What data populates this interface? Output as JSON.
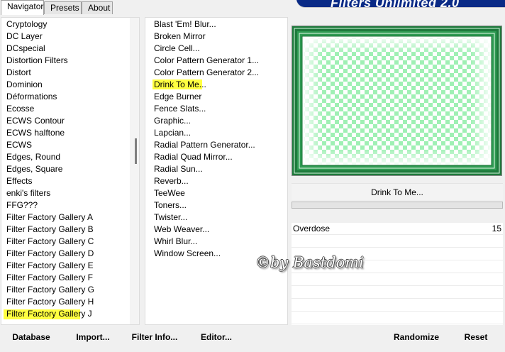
{
  "tabs": [
    {
      "label": "Navigator",
      "active": true
    },
    {
      "label": "Presets",
      "active": false
    },
    {
      "label": "About",
      "active": false
    }
  ],
  "banner": {
    "title": "Filters Unlimited 2.0"
  },
  "categories": [
    "Cryptology",
    "DC Layer",
    "DCspecial",
    "Distortion Filters",
    "Distort",
    "Dominion",
    "Déformations",
    "Ecosse",
    "ECWS Contour",
    "ECWS halftone",
    "ECWS",
    "Edges, Round",
    "Edges, Square",
    "Effects",
    "enki's filters",
    "FFG???",
    "Filter Factory Gallery A",
    "Filter Factory Gallery B",
    "Filter Factory Gallery C",
    "Filter Factory Gallery D",
    "Filter Factory Gallery E",
    "Filter Factory Gallery F",
    "Filter Factory Gallery G",
    "Filter Factory Gallery H",
    "Filter Factory Gallery J"
  ],
  "selected_category": "Filter Factory Gallery J",
  "filters": [
    "Blast 'Em! Blur...",
    "Broken Mirror",
    "Circle Cell...",
    "Color Pattern Generator 1...",
    "Color Pattern Generator 2...",
    "Drink To Me...",
    "Edge Burner",
    "Fence Slats...",
    "Graphic...",
    "Lapcian...",
    "Radial Pattern Generator...",
    "Radial Quad Mirror...",
    "Radial Sun...",
    "Reverb...",
    "TeeWee",
    "Toners...",
    "Twister...",
    "Web Weaver...",
    "Whirl Blur...",
    "Window Screen..."
  ],
  "selected_filter": "Drink To Me...",
  "filter_name_button": "Drink To Me...",
  "parameters": [
    {
      "name": "Overdose",
      "value": "15"
    }
  ],
  "watermark": "©by Bastdomi",
  "buttons": {
    "database": "Database",
    "import": "Import...",
    "filter_info": "Filter Info...",
    "editor": "Editor...",
    "randomize": "Randomize",
    "reset": "Reset"
  },
  "colors": {
    "highlight": "#ffff40",
    "banner": "#0a2a86",
    "preview_green": "#1e7a3c",
    "preview_check": "#9ff0b4"
  }
}
